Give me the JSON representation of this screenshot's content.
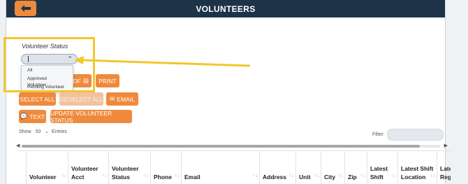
{
  "header": {
    "title": "VOLUNTEERS"
  },
  "filter_panel": {
    "status_label": "Volunteer Status",
    "options": [
      "All",
      "Approved Volunteer",
      "Pending Volunteer"
    ]
  },
  "toolbar": {
    "pdf_label": "PDF",
    "print_label": "PRINT",
    "select_all_label": "SELECT ALL",
    "deselect_all_label": "DESELECT ALL",
    "email_label": "EMAIL",
    "text_label": "TEXT",
    "update_status_label": "UPDATE VOLUNTEER STATUS"
  },
  "table_controls": {
    "show_label": "Show",
    "entries_value": "50",
    "entries_label": "Entries",
    "filter_label": "Filter:"
  },
  "columns": [
    "Volunteer",
    "Volunteer Acct",
    "Volunteer Status",
    "Phone",
    "Email",
    "Address",
    "Unit",
    "City",
    "Zip",
    "Latest Shift",
    "Latest Shift Location",
    "Latest Reg"
  ],
  "colors": {
    "accent": "#ef8a3d",
    "header": "#1d3448",
    "highlight": "#f2c72b"
  }
}
